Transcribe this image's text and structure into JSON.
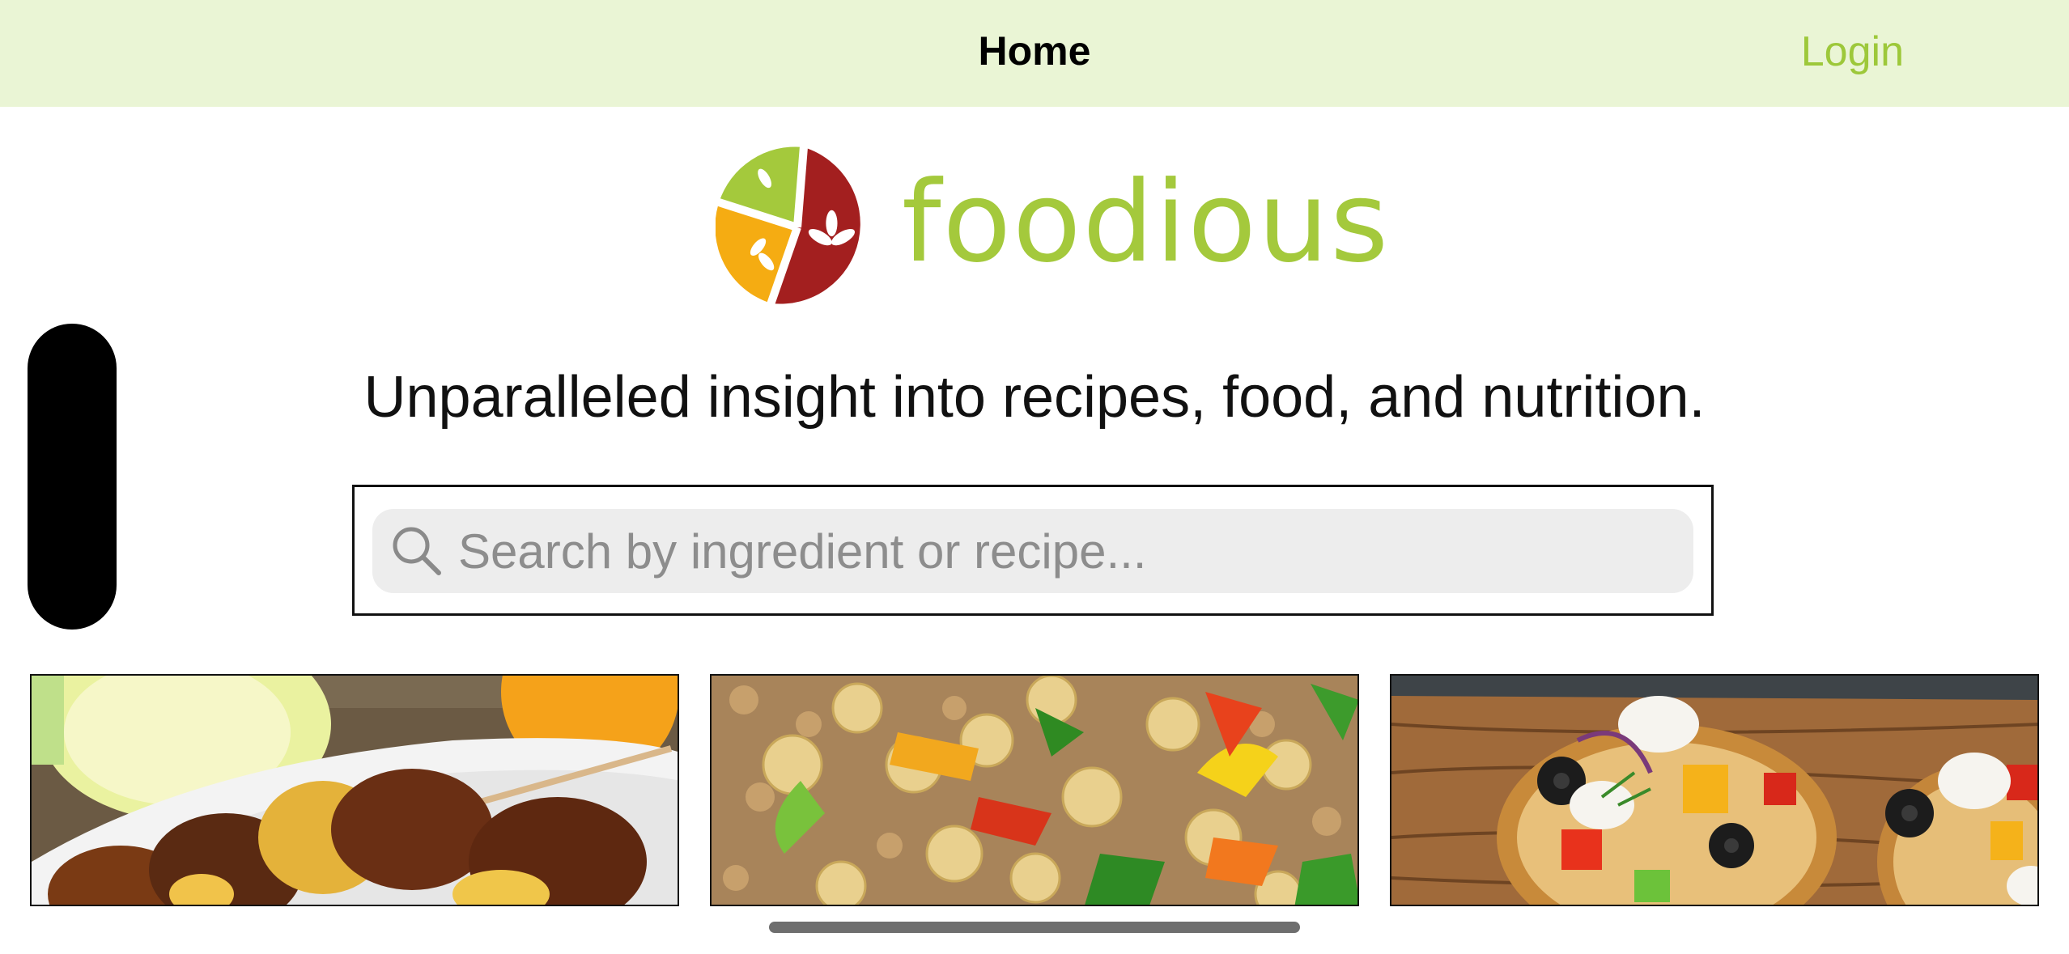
{
  "nav": {
    "title": "Home",
    "login_label": "Login"
  },
  "brand": {
    "name": "foodious",
    "colors": {
      "green": "#a4c93c",
      "red": "#a31f1f",
      "orange": "#f5ac12"
    }
  },
  "hero": {
    "tagline": "Unparalleled insight into recipes, food, and nutrition."
  },
  "search": {
    "placeholder": "Search by ingredient or recipe..."
  },
  "cards": [
    {
      "icon": "grilled-chicken-skewers-photo"
    },
    {
      "icon": "chickpea-salad-photo"
    },
    {
      "icon": "bruschetta-photo"
    }
  ]
}
